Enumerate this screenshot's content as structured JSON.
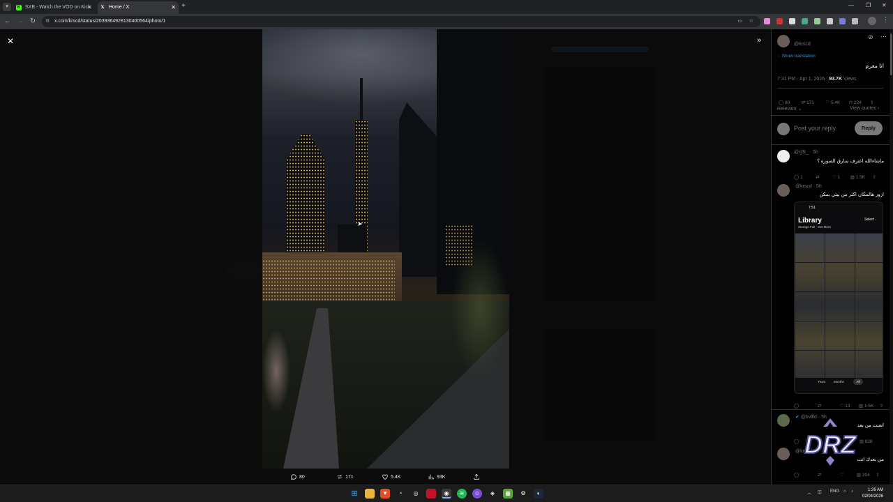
{
  "browser": {
    "tabs": [
      {
        "title": "SXB - Watch the VOD on Kick",
        "icon": "kick-icon"
      },
      {
        "title": "Home / X",
        "icon": "x-icon"
      }
    ],
    "url": "x.com/krscd/status/2039364928130400564/photo/1"
  },
  "viewer": {
    "bottom_actions": {
      "replies": "80",
      "reposts": "171",
      "likes": "5.4K",
      "views": "93K"
    }
  },
  "post": {
    "handle": "@krscd",
    "show_translation": "Show translation",
    "text": "انا مغرم",
    "time": "7:31 PM · Apr 1, 2026 · ",
    "views_count": "93.7K",
    "views_label": " Views",
    "stats": {
      "replies": "80",
      "reposts": "171",
      "likes": "5.4K",
      "bookmarks": "224"
    },
    "sort_label": "Relevant",
    "view_quotes": "View quotes",
    "reply_placeholder": "Post your reply",
    "reply_button": "Reply"
  },
  "replies": [
    {
      "handle": "@rj3t_ · 5h",
      "text": "ماشاءالله اعترف سارق الصوره ؟",
      "stats": {
        "reposts": "",
        "likes": "1",
        "views": "1.5K",
        "replies": "1"
      }
    },
    {
      "handle": "@krscd · 5h",
      "text": "ازور هالمكان اكثر من بيتي يمكن",
      "stats": {
        "replies": "",
        "reposts": "",
        "likes": "13",
        "views": "1.5K"
      },
      "phone": {
        "time": "7:51",
        "title": "Library",
        "subtitle": "Storage Full · Get More",
        "select": "Select",
        "tabs": [
          "Years",
          "Months",
          "All"
        ]
      }
    },
    {
      "handle": "@bvllld · 5h",
      "text": "انعيت من بعد",
      "stats": {
        "views": "638"
      }
    },
    {
      "handle": "@krscd",
      "text": "من بعدك انت",
      "stats": {
        "views": "204"
      }
    }
  ],
  "taskbar": {
    "lang": "ENG",
    "time": "1:26 AM",
    "date": "02/04/2026"
  },
  "watermark": "DRZ"
}
